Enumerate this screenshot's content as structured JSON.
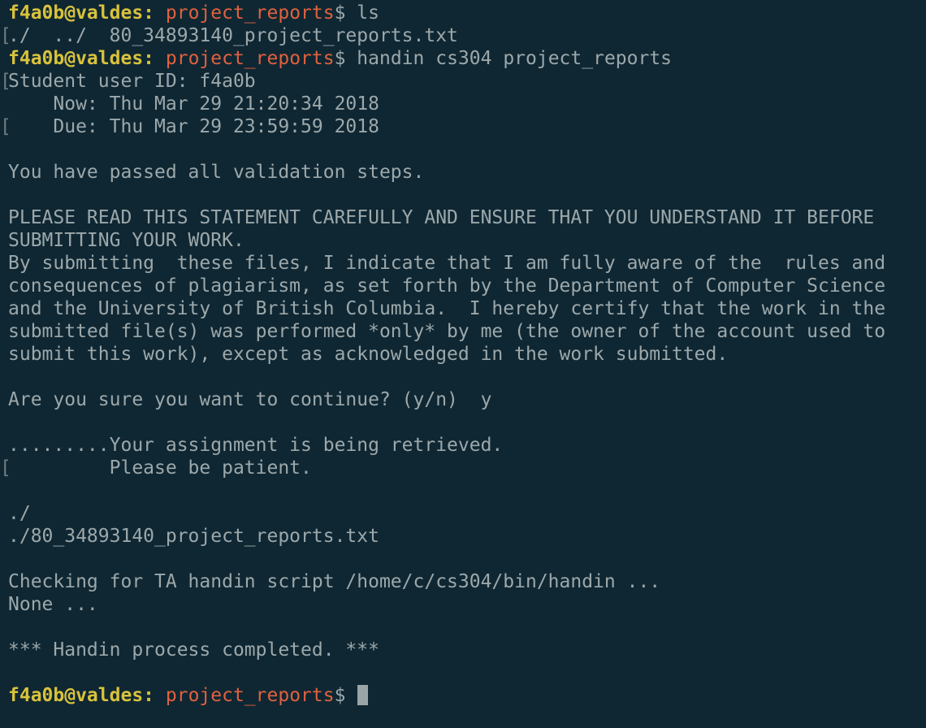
{
  "colors": {
    "background": "#0f2733",
    "text": "#9ca8aa",
    "prompt_user_host": "#d8c23c",
    "prompt_cwd": "#e0613e",
    "cursor": "#9aa5a7"
  },
  "prompt": {
    "user_host": "f4a0b@valdes:",
    "cwd": "project_reports",
    "symbol": "$"
  },
  "lines": [
    {
      "type": "prompt",
      "command": " ls",
      "gutter": ""
    },
    {
      "type": "text",
      "text": "./  ../  80_34893140_project_reports.txt",
      "gutter": "["
    },
    {
      "type": "prompt",
      "command": " handin cs304 project_reports",
      "gutter": ""
    },
    {
      "type": "text",
      "text": "Student user ID: f4a0b",
      "gutter": "["
    },
    {
      "type": "text",
      "text": "    Now: Thu Mar 29 21:20:34 2018",
      "gutter": ""
    },
    {
      "type": "text",
      "text": "    Due: Thu Mar 29 23:59:59 2018",
      "gutter": "["
    },
    {
      "type": "text",
      "text": "",
      "gutter": ""
    },
    {
      "type": "text",
      "text": "You have passed all validation steps.",
      "gutter": ""
    },
    {
      "type": "text",
      "text": "",
      "gutter": ""
    },
    {
      "type": "text",
      "text": "PLEASE READ THIS STATEMENT CAREFULLY AND ENSURE THAT YOU UNDERSTAND IT BEFORE",
      "gutter": ""
    },
    {
      "type": "text",
      "text": "SUBMITTING YOUR WORK.",
      "gutter": ""
    },
    {
      "type": "text",
      "text": "By submitting  these files, I indicate that I am fully aware of the  rules and",
      "gutter": ""
    },
    {
      "type": "text",
      "text": "consequences of plagiarism, as set forth by the Department of Computer Science",
      "gutter": ""
    },
    {
      "type": "text",
      "text": "and the University of British Columbia.  I hereby certify that the work in the",
      "gutter": ""
    },
    {
      "type": "text",
      "text": "submitted file(s) was performed *only* by me (the owner of the account used to",
      "gutter": ""
    },
    {
      "type": "text",
      "text": "submit this work), except as acknowledged in the work submitted.",
      "gutter": ""
    },
    {
      "type": "text",
      "text": "",
      "gutter": ""
    },
    {
      "type": "text",
      "text": "Are you sure you want to continue? (y/n)  y",
      "gutter": ""
    },
    {
      "type": "text",
      "text": "",
      "gutter": ""
    },
    {
      "type": "text",
      "text": ".........Your assignment is being retrieved.",
      "gutter": ""
    },
    {
      "type": "text",
      "text": "         Please be patient.",
      "gutter": "["
    },
    {
      "type": "text",
      "text": "",
      "gutter": ""
    },
    {
      "type": "text",
      "text": "./",
      "gutter": ""
    },
    {
      "type": "text",
      "text": "./80_34893140_project_reports.txt",
      "gutter": ""
    },
    {
      "type": "text",
      "text": "",
      "gutter": ""
    },
    {
      "type": "text",
      "text": "Checking for TA handin script /home/c/cs304/bin/handin ...",
      "gutter": ""
    },
    {
      "type": "text",
      "text": "None ...",
      "gutter": ""
    },
    {
      "type": "text",
      "text": "",
      "gutter": ""
    },
    {
      "type": "text",
      "text": "*** Handin process completed. ***",
      "gutter": ""
    },
    {
      "type": "text",
      "text": "",
      "gutter": ""
    },
    {
      "type": "prompt",
      "command": " ",
      "gutter": "",
      "cursor": true
    }
  ]
}
